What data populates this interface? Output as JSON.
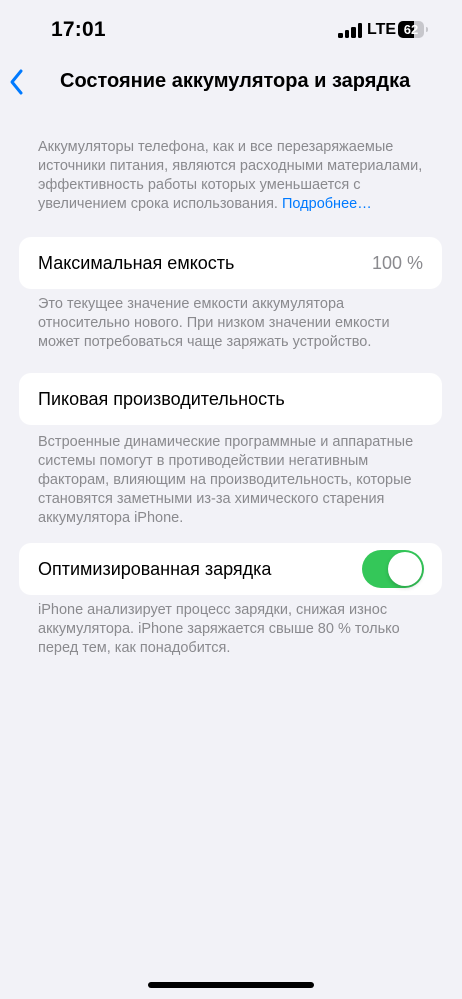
{
  "status_bar": {
    "time": "17:01",
    "network": "LTE",
    "battery_level": "62",
    "battery_fraction": 0.62
  },
  "nav": {
    "back_icon": "chevron-left-icon",
    "title": "Состояние аккумулятора и зарядка"
  },
  "intro": {
    "text": "Аккумуляторы телефона, как и все перезаряжаемые источники питания, являются расходными материа­лами, эффективность работы которых уменьшается с увеличением срока использования. ",
    "link": "Подробнее…"
  },
  "max_capacity": {
    "label": "Максимальная емкость",
    "value": "100 %",
    "footer": "Это текущее значение емкости аккумулятора относительно нового. При низком значении емкости может потребоваться чаще заряжать устройство."
  },
  "peak_performance": {
    "label": "Пиковая производительность",
    "footer": "Встроенные динамические программные и аппарат­ные системы помогут в противодействии негативным факторам, влияющим на производительность, которые становятся заметными из-за химического старения аккумулятора iPhone."
  },
  "optimized_charging": {
    "label": "Оптимизированная зарядка",
    "enabled": true,
    "footer": "iPhone анализирует процесс зарядки, снижая износ аккумулятора. iPhone заряжается свыше 80 % только перед тем, как понадобится."
  },
  "colors": {
    "accent": "#007aff",
    "toggle_on": "#34c759",
    "background": "#f2f2f7",
    "secondary_text": "#8a8a8e"
  }
}
